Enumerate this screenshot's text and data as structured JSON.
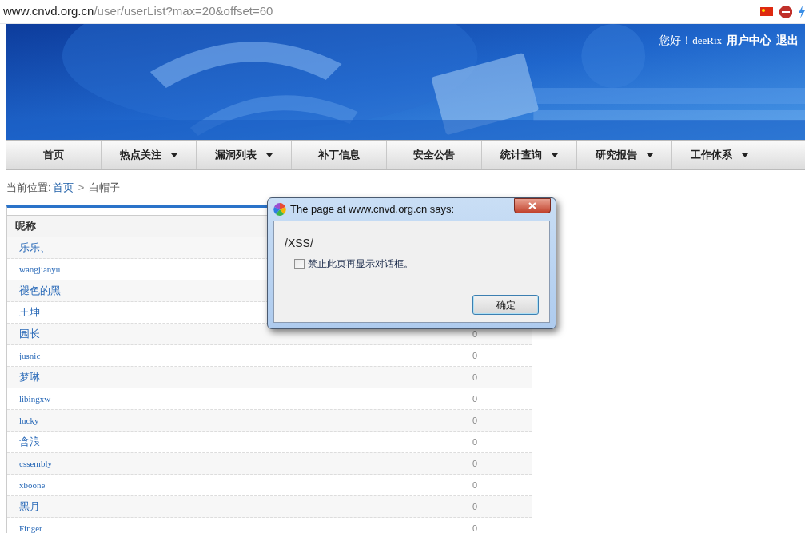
{
  "address_bar": {
    "domain": "www.cnvd.org.cn",
    "path": "/user/userList?max=20&offset=60"
  },
  "header": {
    "greeting": "您好！",
    "username": "deeRix",
    "links": [
      "用户中心",
      "退出"
    ]
  },
  "nav": [
    {
      "label": "首页",
      "dropdown": false
    },
    {
      "label": "热点关注",
      "dropdown": true
    },
    {
      "label": "漏洞列表",
      "dropdown": true
    },
    {
      "label": "补丁信息",
      "dropdown": false
    },
    {
      "label": "安全公告",
      "dropdown": false
    },
    {
      "label": "统计查询",
      "dropdown": true
    },
    {
      "label": "研究报告",
      "dropdown": true
    },
    {
      "label": "工作体系",
      "dropdown": true
    }
  ],
  "breadcrumb": {
    "label": "当前位置:",
    "home": "首页",
    "separator": ">",
    "current": "白帽子"
  },
  "table": {
    "columns": [
      "昵称"
    ],
    "rows": [
      {
        "name": "乐乐、"
      },
      {
        "name": "wangjianyu"
      },
      {
        "name": "褪色的黑"
      },
      {
        "name": "王坤"
      },
      {
        "name": "园长",
        "count": "0"
      },
      {
        "name": "jusnic",
        "count": "0"
      },
      {
        "name": "梦琳",
        "count": "0"
      },
      {
        "name": "libingxw",
        "count": "0"
      },
      {
        "name": "lucky",
        "count": "0"
      },
      {
        "name": "含浪",
        "count": "0"
      },
      {
        "name": "cssembly",
        "count": "0"
      },
      {
        "name": "xboone",
        "count": "0"
      },
      {
        "name": "黑月",
        "count": "0"
      },
      {
        "name": "Finger",
        "count": "0"
      }
    ]
  },
  "dialog": {
    "title": "The page at www.cnvd.org.cn says:",
    "message": "/XSS/",
    "checkbox": {
      "label": "禁止此页再显示对话框。",
      "checked": false
    },
    "button": "确定"
  }
}
